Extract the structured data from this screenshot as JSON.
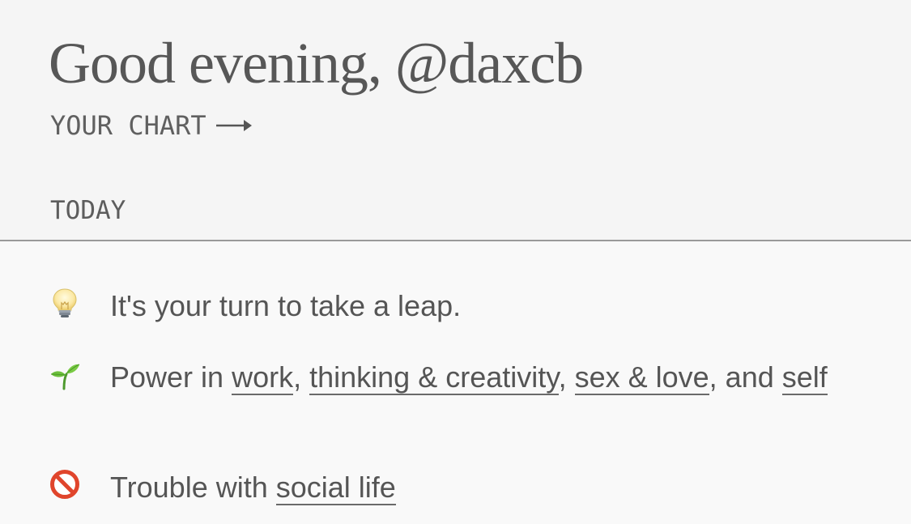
{
  "greeting": "Good evening, @daxcb",
  "chart_link": {
    "label": "YOUR CHART",
    "icon": "arrow-right-icon"
  },
  "section": {
    "label": "TODAY"
  },
  "items": [
    {
      "icon": "lightbulb-icon",
      "text": "It's your turn to take a leap."
    },
    {
      "icon": "seedling-icon",
      "prefix": "Power in ",
      "links": [
        "work",
        "thinking & creativity",
        "sex & love",
        "self"
      ],
      "sep1": ", ",
      "sep2": ", ",
      "sep3": ", and ",
      "suffix": ""
    },
    {
      "icon": "no-entry-icon",
      "prefix": "Trouble with ",
      "links": [
        "social life"
      ]
    }
  ]
}
